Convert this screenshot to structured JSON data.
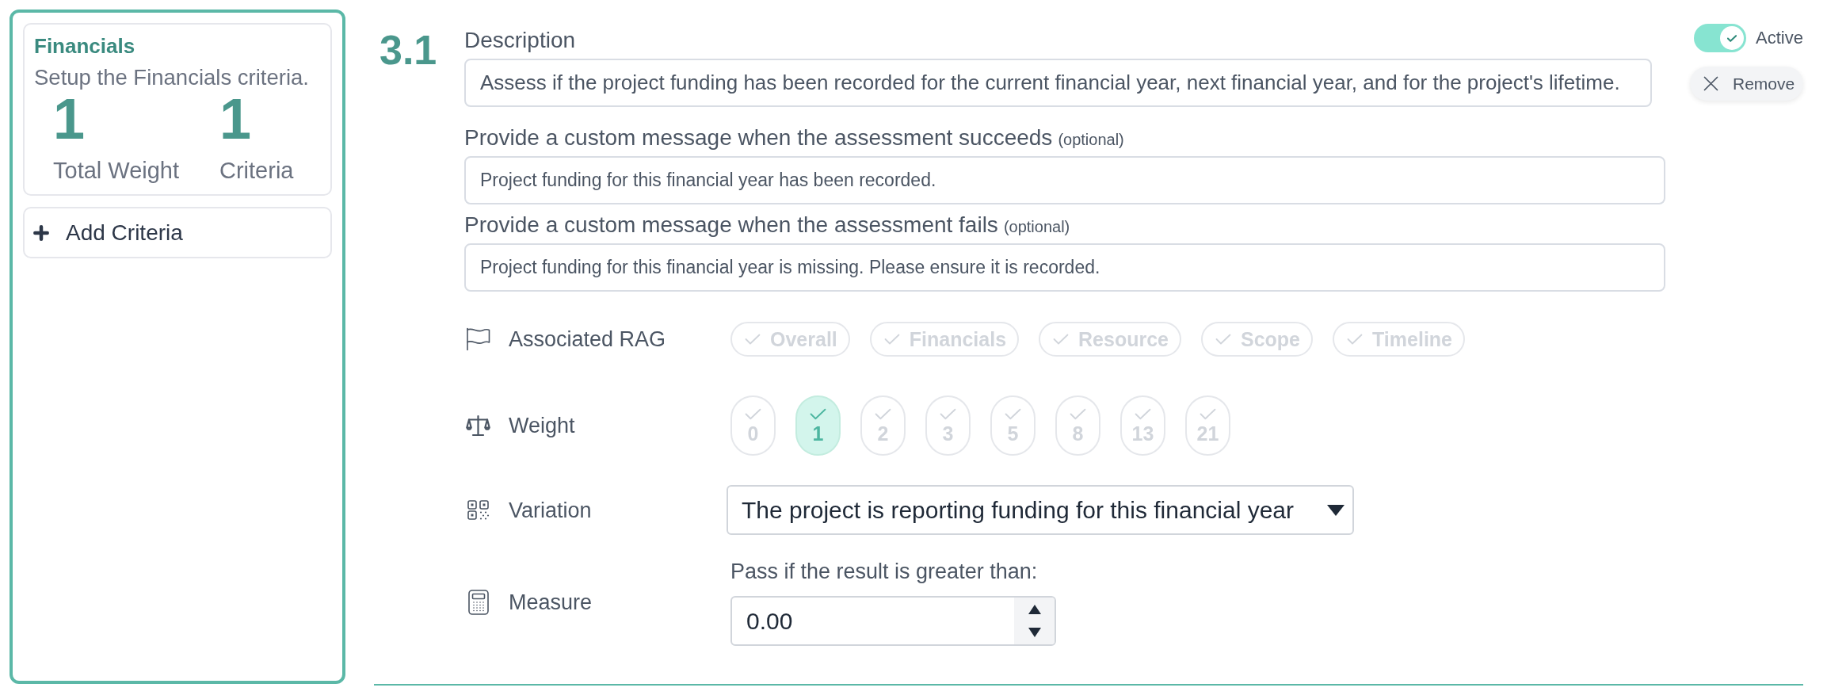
{
  "sidebar": {
    "card": {
      "title": "Financials",
      "description": "Setup the Financials criteria.",
      "stats": [
        {
          "value": "1",
          "label": "Total Weight"
        },
        {
          "value": "1",
          "label": "Criteria"
        }
      ]
    },
    "add_button": "Add Criteria"
  },
  "criterion": {
    "number": "3.1",
    "fields": [
      {
        "kind": "description",
        "label": "Description",
        "value": "Assess if the project funding has been recorded for the current financial year, next financial year, and for the project's lifetime."
      },
      {
        "kind": "message",
        "label": "Provide a custom message when the assessment succeeds",
        "note": "(optional)",
        "value": "Project funding for this financial year has been recorded."
      },
      {
        "kind": "message",
        "label": "Provide a custom message when the assessment fails",
        "note": "(optional)",
        "value": "Project funding for this financial year is missing. Please ensure it is recorded."
      }
    ],
    "rows": [
      {
        "kind": "rag",
        "label": "Associated RAG",
        "options": [
          {
            "label": "Overall",
            "selected": false
          },
          {
            "label": "Financials",
            "selected": false
          },
          {
            "label": "Resource",
            "selected": false
          },
          {
            "label": "Scope",
            "selected": false
          },
          {
            "label": "Timeline",
            "selected": false
          }
        ]
      },
      {
        "kind": "weight",
        "label": "Weight",
        "options": [
          {
            "label": "0",
            "selected": false
          },
          {
            "label": "1",
            "selected": true
          },
          {
            "label": "2",
            "selected": false
          },
          {
            "label": "3",
            "selected": false
          },
          {
            "label": "5",
            "selected": false
          },
          {
            "label": "8",
            "selected": false
          },
          {
            "label": "13",
            "selected": false
          },
          {
            "label": "21",
            "selected": false
          }
        ]
      },
      {
        "kind": "dropdown",
        "label": "Variation",
        "value": "The project is reporting funding for this financial year"
      },
      {
        "kind": "number",
        "label": "Measure",
        "caption": "Pass if the result is greater than:",
        "value": "0.00"
      }
    ],
    "active_toggle": {
      "label": "Active",
      "on": true
    },
    "remove_button": "Remove"
  }
}
